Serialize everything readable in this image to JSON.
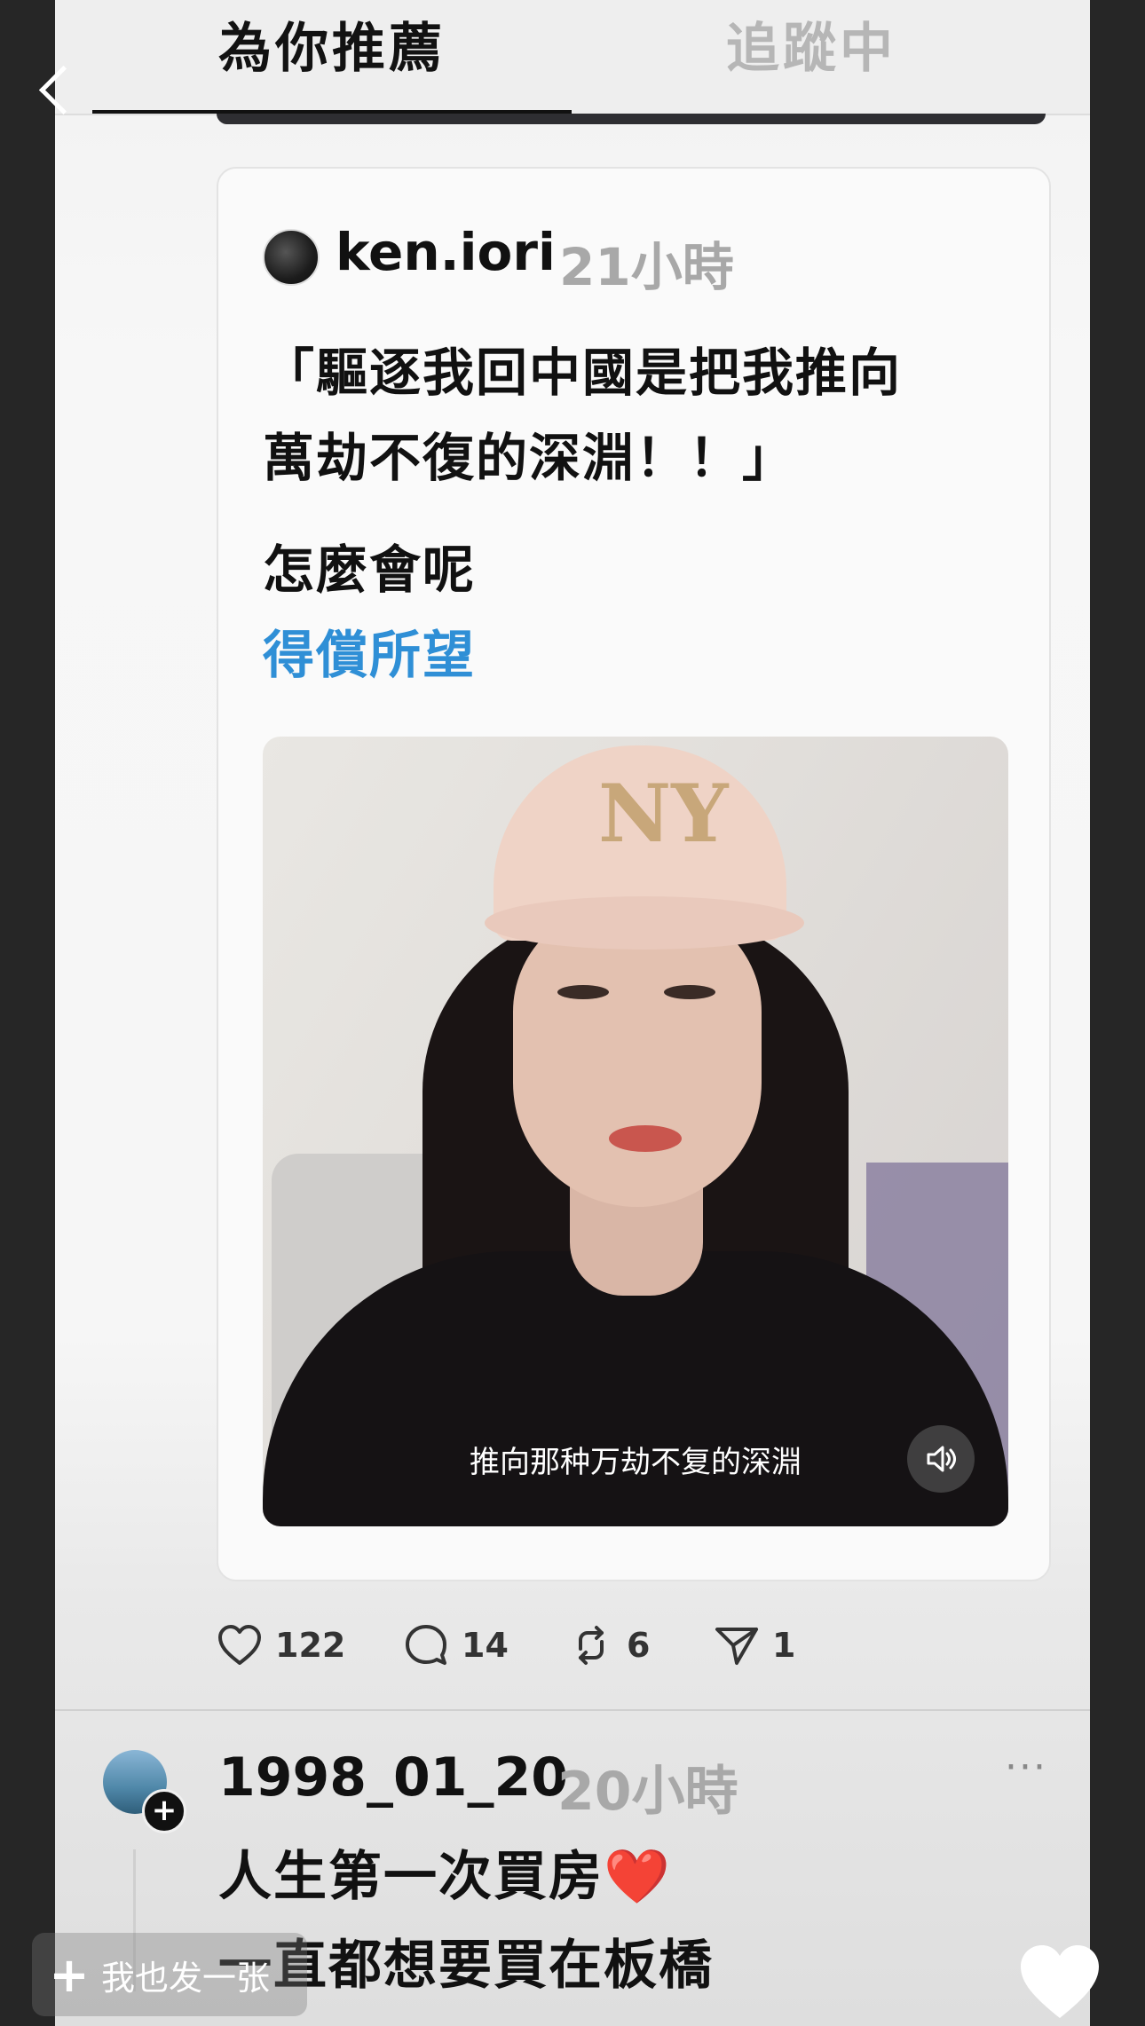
{
  "tabs": {
    "for_you": "為你推薦",
    "following": "追蹤中"
  },
  "quoted_post": {
    "username": "ken.iori",
    "time": "21小時",
    "quote_line1": "「驅逐我回中國是把我推向",
    "quote_line2": "萬劫不復的深淵！！」",
    "comment": "怎麼會呢",
    "link_text": "得償所望",
    "video": {
      "subtitle": "推向那种万劫不复的深淵",
      "logo": "NY",
      "sound_icon": "speaker-icon"
    }
  },
  "actions": {
    "likes": "122",
    "comments": "14",
    "reposts": "6",
    "shares": "1"
  },
  "next_post": {
    "username": "1998_01_20",
    "time": "20小時",
    "more": "···",
    "line1": "人生第一次買房",
    "line1_emoji": "❤️",
    "line2": "一直都想要買在板橋"
  },
  "overlay": {
    "make_button": "我也发一张",
    "plus": "+"
  },
  "colors": {
    "link": "#2f8fd6",
    "heart": "#d4213d",
    "muted": "#a8a8a8"
  }
}
